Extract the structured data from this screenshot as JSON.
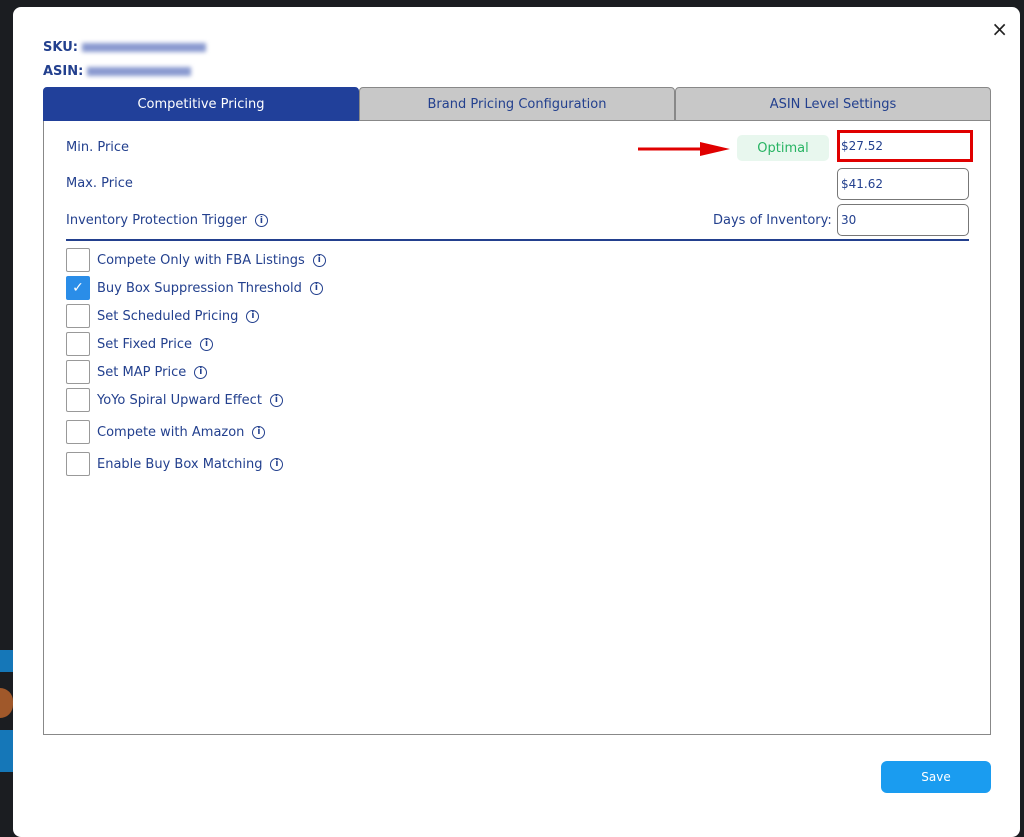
{
  "modal": {
    "close_icon": "×",
    "sku_label": "SKU:",
    "asin_label": "ASIN:"
  },
  "tabs": [
    {
      "label": "Competitive Pricing",
      "active": true
    },
    {
      "label": "Brand Pricing Configuration"
    },
    {
      "label": "ASIN Level Settings"
    }
  ],
  "form": {
    "min_price_label": "Min. Price",
    "min_price_value": "$27.52",
    "status_badge": "Optimal",
    "status_color": "#28b463",
    "highlight_color": "#e00000",
    "max_price_label": "Max. Price",
    "max_price_value": "$41.62",
    "inventory_trigger_label": "Inventory Protection Trigger",
    "days_label": "Days of Inventory:",
    "days_value": "30"
  },
  "options": [
    {
      "label": "Compete Only with FBA Listings",
      "checked": false
    },
    {
      "label": "Buy Box Suppression Threshold",
      "checked": true
    },
    {
      "label": "Set Scheduled Pricing",
      "checked": false
    },
    {
      "label": "Set Fixed Price",
      "checked": false
    },
    {
      "label": "Set MAP Price",
      "checked": false
    },
    {
      "label": "YoYo Spiral Upward Effect",
      "checked": false
    },
    {
      "label": "Compete with Amazon",
      "checked": false
    },
    {
      "label": "Enable Buy Box Matching",
      "checked": false
    }
  ],
  "save_label": "Save"
}
